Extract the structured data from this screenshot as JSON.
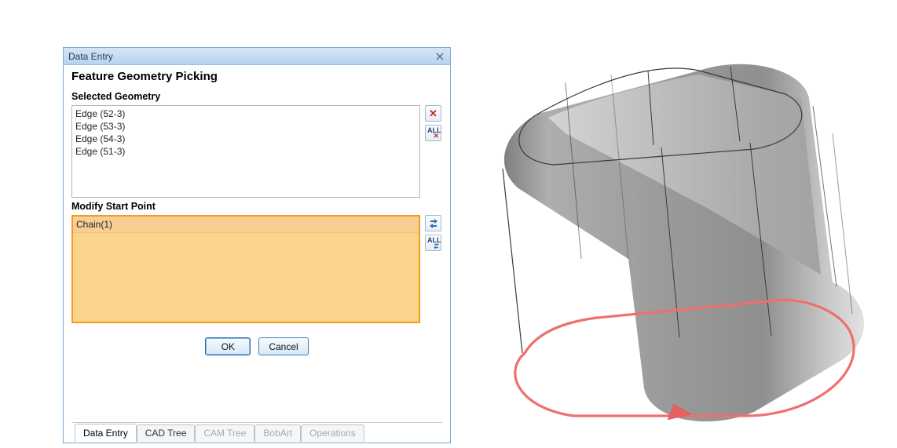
{
  "window": {
    "title": "Data Entry"
  },
  "heading": "Feature Geometry Picking",
  "sections": {
    "selected": {
      "title": "Selected Geometry",
      "items": [
        "Edge (52-3)",
        "Edge (53-3)",
        "Edge (54-3)",
        "Edge (51-3)"
      ]
    },
    "modify": {
      "title": "Modify Start Point",
      "items": [
        "Chain(1)"
      ]
    }
  },
  "side_labels": {
    "all": "ALL"
  },
  "buttons": {
    "ok": "OK",
    "cancel": "Cancel"
  },
  "tabs": [
    "Data Entry",
    "CAD Tree",
    "CAM Tree",
    "BobArt",
    "Operations"
  ]
}
